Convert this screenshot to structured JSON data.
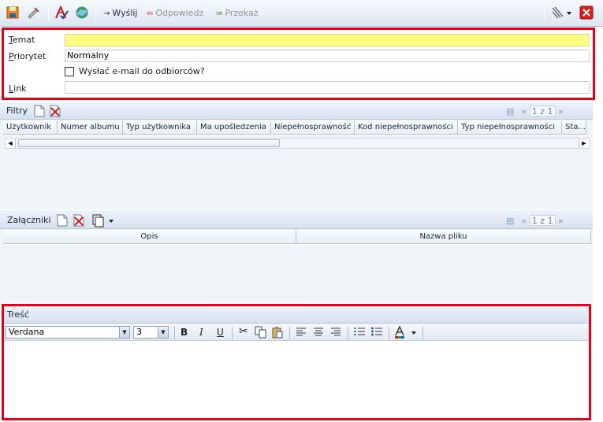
{
  "toolbar": {
    "send_label": "Wyślij",
    "reply_label": "Odpowiedz",
    "forward_label": "Przekaż"
  },
  "form": {
    "subject_label": "Temat",
    "subject_value": "",
    "priority_label": "Priorytet",
    "priority_value": "Normalny",
    "email_checkbox_label": "Wysłać e-mail do odbiorców?",
    "email_checkbox_checked": false,
    "link_label": "Link",
    "link_value": ""
  },
  "filters": {
    "title": "Filtry",
    "pager": "1 z 1",
    "columns": [
      "Użytkownik",
      "Numer albumu",
      "Typ użytkownika",
      "Ma upośledzenia",
      "Niepełnosprawność",
      "Kod niepełnosprawności",
      "Typ niepełnosprawności",
      "Sta..."
    ]
  },
  "attachments": {
    "title": "Załączniki",
    "pager": "1 z 1",
    "columns": [
      "Opis",
      "Nazwa pliku"
    ]
  },
  "editor": {
    "title": "Treść",
    "font_family": "Verdana",
    "font_size": "3"
  },
  "colors": {
    "highlight_border": "#e8001a",
    "subject_fill": "#ffff80",
    "header_strip": "#d6e0ef"
  }
}
